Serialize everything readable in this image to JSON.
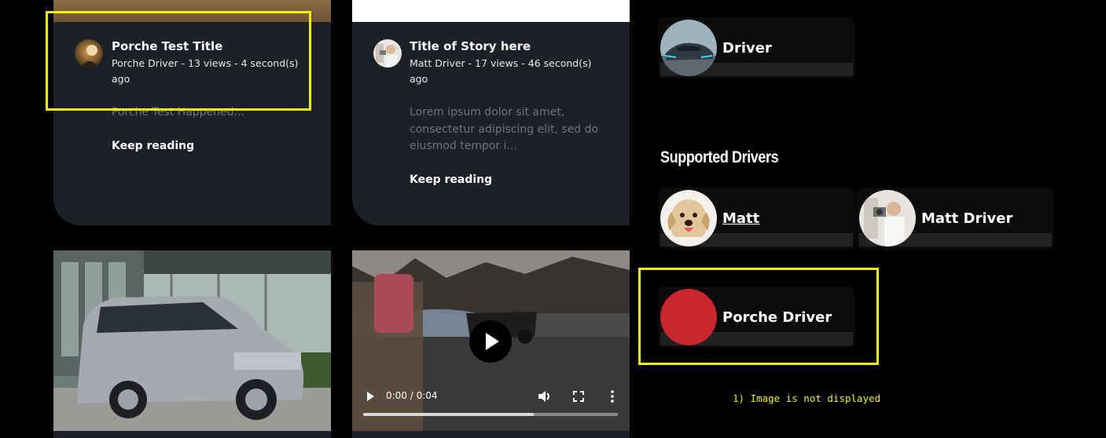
{
  "cards": [
    {
      "title": "Porche Test Title",
      "meta": "Porche Driver - 13 views - 4 second(s) ago",
      "excerpt": "Porche Test Happened...",
      "cta": "Keep reading"
    },
    {
      "title": "Title of Story here",
      "meta": "Matt Driver - 17 views - 46 second(s) ago",
      "excerpt": "Lorem ipsum dolor sit amet, consectetur adipiscing elit, sed do eiusmod tempor i...",
      "cta": "Keep reading"
    }
  ],
  "video": {
    "time": "0:00 / 0:04",
    "progress": 0.67
  },
  "sidebar": {
    "top_driver": "Driver",
    "supported_heading": "Supported Drivers",
    "drivers": [
      {
        "name": "Matt"
      },
      {
        "name": "Matt Driver"
      },
      {
        "name": "Porche Driver"
      }
    ],
    "placeholder_color": "#c9262f"
  },
  "annotation": {
    "color": "#f2f200",
    "note": "1) Image is not displayed"
  }
}
